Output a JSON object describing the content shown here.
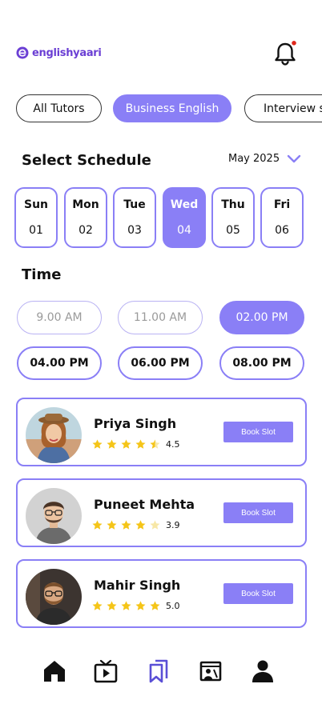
{
  "header": {
    "logo_text": "englishyaari",
    "brand_color": "#6b3fd4",
    "notification_icon": "bell-icon",
    "notification_dot_color": "#e0281c"
  },
  "filters": [
    {
      "label": "All Tutors",
      "active": false
    },
    {
      "label": "Business English",
      "active": true
    },
    {
      "label": "Interview s",
      "active": false
    }
  ],
  "schedule": {
    "title": "Select Schedule",
    "month": "May 2025",
    "days": [
      {
        "name": "Sun",
        "num": "01",
        "active": false
      },
      {
        "name": "Mon",
        "num": "02",
        "active": false
      },
      {
        "name": "Tue",
        "num": "03",
        "active": false
      },
      {
        "name": "Wed",
        "num": "04",
        "active": true
      },
      {
        "name": "Thu",
        "num": "05",
        "active": false
      },
      {
        "name": "Fri",
        "num": "06",
        "active": false
      }
    ]
  },
  "time": {
    "title": "Time",
    "slots": [
      {
        "label": "9.00 AM",
        "state": "disabled"
      },
      {
        "label": "11.00 AM",
        "state": "disabled"
      },
      {
        "label": "02.00 PM",
        "state": "active"
      },
      {
        "label": "04.00 PM",
        "state": "normal"
      },
      {
        "label": "06.00 PM",
        "state": "normal"
      },
      {
        "label": "08.00 PM",
        "state": "normal"
      }
    ]
  },
  "tutors": [
    {
      "name": "Priya Singh",
      "rating": "4.5",
      "stars": 4.5,
      "button": "Book Slot"
    },
    {
      "name": "Puneet Mehta",
      "rating": "3.9",
      "stars": 3.9,
      "button": "Book Slot"
    },
    {
      "name": "Mahir Singh",
      "rating": "5.0",
      "stars": 5.0,
      "button": "Book Slot"
    }
  ],
  "nav": [
    {
      "icon": "home-icon",
      "active": false
    },
    {
      "icon": "video-icon",
      "active": false
    },
    {
      "icon": "bookmarks-icon",
      "active": true
    },
    {
      "icon": "classroom-icon",
      "active": false
    },
    {
      "icon": "profile-icon",
      "active": false
    }
  ],
  "colors": {
    "accent": "#8a7ff6",
    "star": "#f5c518",
    "star_empty": "#f7e7a6"
  }
}
